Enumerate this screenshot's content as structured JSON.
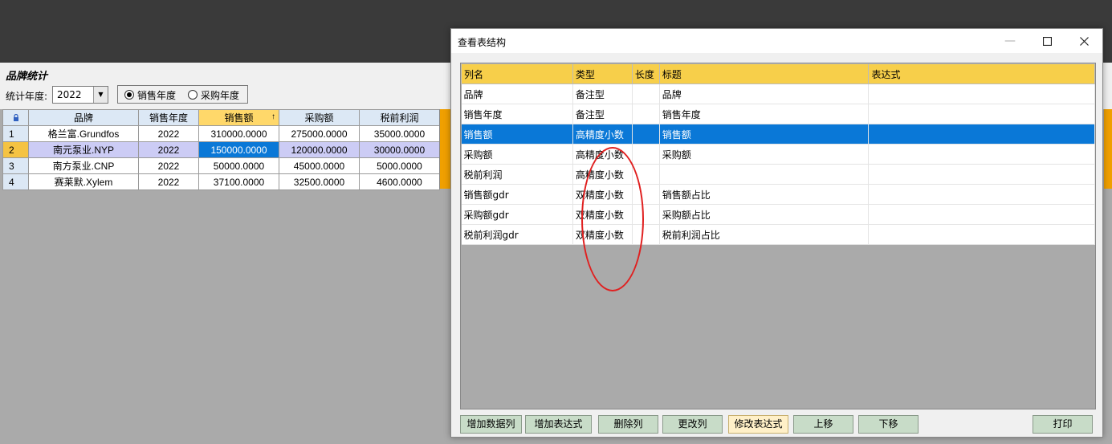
{
  "bg_form": {
    "title": "品牌统计",
    "year_label": "统计年度:",
    "year_value": "2022",
    "radios": [
      {
        "label": "销售年度",
        "checked": true
      },
      {
        "label": "采购年度",
        "checked": false
      }
    ],
    "grid": {
      "columns": [
        "品牌",
        "销售年度",
        "销售额",
        "采购额",
        "税前利润"
      ],
      "sort_indicator": "↑",
      "rows": [
        {
          "n": "1",
          "cells": [
            "格兰富.Grundfos",
            "2022",
            "310000.0000",
            "275000.0000",
            "35000.0000"
          ]
        },
        {
          "n": "2",
          "cells": [
            "南元泵业.NYP",
            "2022",
            "150000.0000",
            "120000.0000",
            "30000.0000"
          ]
        },
        {
          "n": "3",
          "cells": [
            "南方泵业.CNP",
            "2022",
            "50000.0000",
            "45000.0000",
            "5000.0000"
          ]
        },
        {
          "n": "4",
          "cells": [
            "赛莱默.Xylem",
            "2022",
            "37100.0000",
            "32500.0000",
            "4600.0000"
          ]
        }
      ]
    }
  },
  "dialog": {
    "title": "查看表结构",
    "columns": [
      "列名",
      "类型",
      "长度",
      "标题",
      "表达式"
    ],
    "rows": [
      {
        "name": "品牌",
        "type": "备注型",
        "length": "",
        "caption": "品牌",
        "expr": ""
      },
      {
        "name": "销售年度",
        "type": "备注型",
        "length": "",
        "caption": "销售年度",
        "expr": ""
      },
      {
        "name": "销售额",
        "type": "高精度小数",
        "length": "",
        "caption": "销售额",
        "expr": ""
      },
      {
        "name": "采购额",
        "type": "高精度小数",
        "length": "",
        "caption": "采购额",
        "expr": ""
      },
      {
        "name": "税前利润",
        "type": "高精度小数",
        "length": "",
        "caption": "",
        "expr": ""
      },
      {
        "name": "销售额gdr",
        "type": "双精度小数",
        "length": "",
        "caption": "销售额占比",
        "expr": ""
      },
      {
        "name": "采购额gdr",
        "type": "双精度小数",
        "length": "",
        "caption": "采购额占比",
        "expr": ""
      },
      {
        "name": "税前利润gdr",
        "type": "双精度小数",
        "length": "",
        "caption": "税前利润占比",
        "expr": ""
      }
    ],
    "buttons": {
      "add_data_col": "增加数据列",
      "add_expr": "增加表达式",
      "delete_col": "删除列",
      "change_col": "更改列",
      "edit_expr": "修改表达式",
      "move_up": "上移",
      "move_down": "下移",
      "print": "打印"
    }
  }
}
